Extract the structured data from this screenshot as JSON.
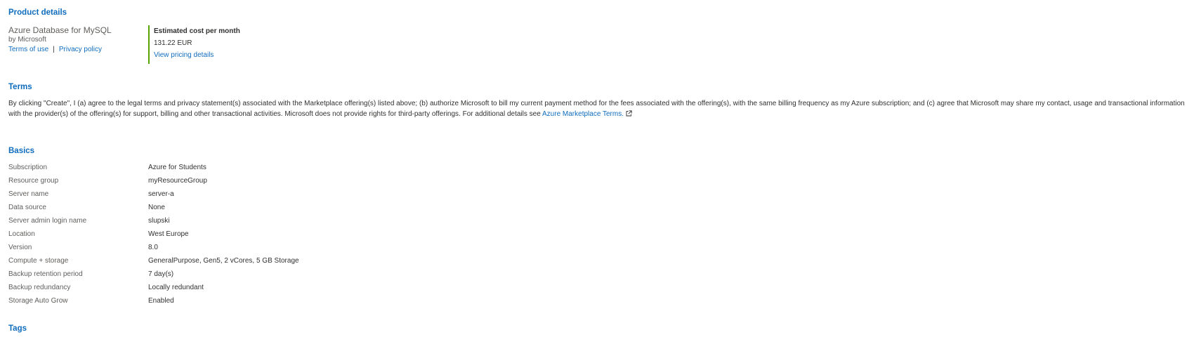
{
  "product_details": {
    "heading": "Product details",
    "product_name": "Azure Database for MySQL",
    "publisher": "by Microsoft",
    "terms_of_use": "Terms of use",
    "separator": "|",
    "privacy_policy": "Privacy policy",
    "cost": {
      "label": "Estimated cost per month",
      "value": "131.22 EUR",
      "link": "View pricing details"
    }
  },
  "terms": {
    "heading": "Terms",
    "body": "By clicking \"Create\", I (a) agree to the legal terms and privacy statement(s) associated with the Marketplace offering(s) listed above; (b) authorize Microsoft to bill my current payment method for the fees associated with the offering(s), with the same billing frequency as my Azure subscription; and (c) agree that Microsoft may share my contact, usage and transactional information with the provider(s) of the offering(s) for support, billing and other transactional activities. Microsoft does not provide rights for third-party offerings. For additional details see ",
    "link": "Azure Marketplace Terms."
  },
  "basics": {
    "heading": "Basics",
    "rows": [
      {
        "key": "Subscription",
        "value": "Azure for Students"
      },
      {
        "key": "Resource group",
        "value": "myResourceGroup"
      },
      {
        "key": "Server name",
        "value": "server-a"
      },
      {
        "key": "Data source",
        "value": "None"
      },
      {
        "key": "Server admin login name",
        "value": "slupski"
      },
      {
        "key": "Location",
        "value": "West Europe"
      },
      {
        "key": "Version",
        "value": "8.0"
      },
      {
        "key": "Compute + storage",
        "value": "GeneralPurpose, Gen5, 2 vCores, 5 GB Storage"
      },
      {
        "key": "Backup retention period",
        "value": "7 day(s)"
      },
      {
        "key": "Backup redundancy",
        "value": "Locally redundant"
      },
      {
        "key": "Storage Auto Grow",
        "value": "Enabled"
      }
    ]
  },
  "tags": {
    "heading": "Tags"
  },
  "icons": {
    "external_link": "external-link-icon"
  },
  "colors": {
    "accent": "#0f6cbd",
    "cost_border": "#57a300",
    "text": "#323130",
    "label": "#605e5c"
  }
}
